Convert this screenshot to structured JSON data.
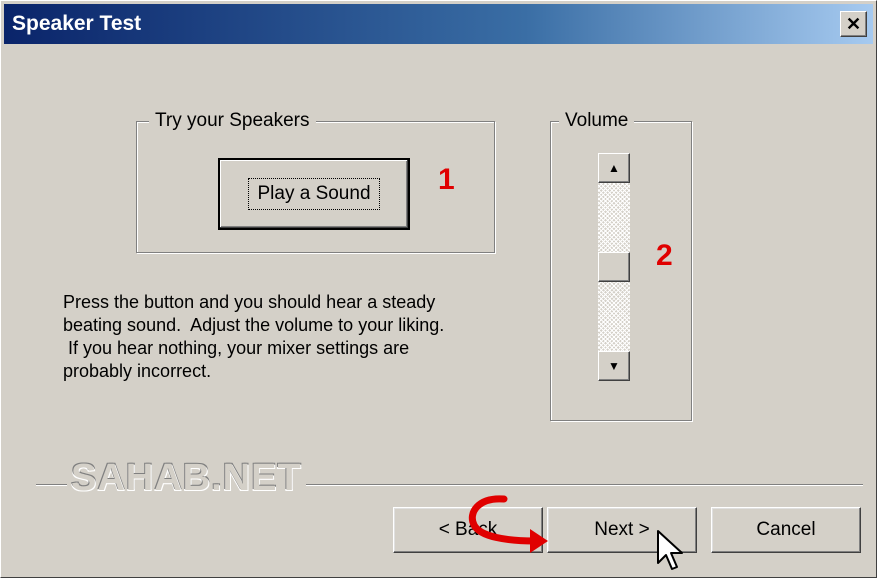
{
  "window": {
    "title": "Speaker Test",
    "close_glyph": "✕"
  },
  "speakers_group": {
    "label": "Try your Speakers",
    "play_button_label": "Play a Sound"
  },
  "volume_group": {
    "label": "Volume",
    "up_glyph": "▲",
    "down_glyph": "▼",
    "slider_level_fraction": 0.5
  },
  "markers": {
    "one": "1",
    "two": "2"
  },
  "description": "Press the button and you should hear a steady\nbeating sound.  Adjust the volume to your liking.\n If you hear nothing, your mixer settings are\nprobably incorrect.",
  "watermark": "SAHAB.NET",
  "footer": {
    "back_label": "< Back",
    "next_label": "Next >",
    "cancel_label": "Cancel"
  },
  "accent": {
    "annotation_red": "#e00000",
    "titlebar_start": "#0a246a",
    "titlebar_end": "#a6caf0"
  },
  "icons": [
    "close-icon",
    "scroll-up-arrow-icon",
    "scroll-down-arrow-icon",
    "curved-arrow-icon",
    "mouse-cursor-icon"
  ]
}
